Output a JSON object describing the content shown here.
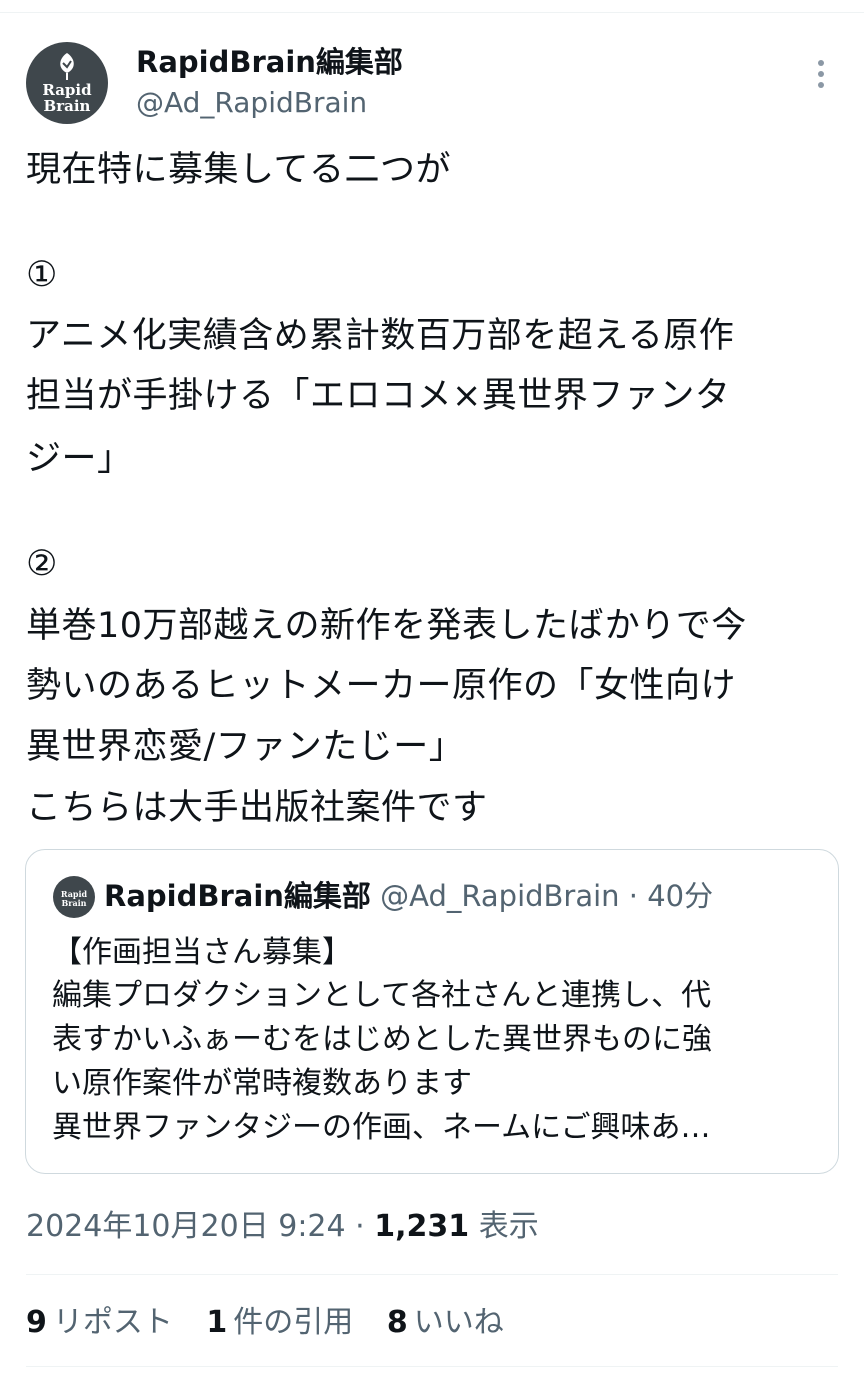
{
  "author": {
    "display_name": "RapidBrain編集部",
    "handle": "@Ad_RapidBrain",
    "avatar_text": [
      "Rapid",
      "Brain"
    ]
  },
  "tweet": {
    "lines": [
      "現在特に募集してる二つが",
      "①",
      "アニメ化実績含め累計数百万部を超える原作",
      "担当が手掛ける「エロコメ×異世界ファンタ",
      "ジー」",
      "②",
      "単巻10万部越えの新作を発表したばかりで今",
      "勢いのあるヒットメーカー原作の「女性向け",
      "異世界恋愛/ファンたじー」",
      "こちらは大手出版社案件です"
    ]
  },
  "quote": {
    "display_name": "RapidBrain編集部",
    "handle": "@Ad_RapidBrain",
    "separator": "·",
    "time": "40分",
    "avatar_text": [
      "Rapid",
      "Brain"
    ],
    "lines": [
      "【作画担当さん募集】",
      "編集プロダクションとして各社さんと連携し、代",
      "表すかいふぁーむをはじめとした異世界ものに強",
      "い原作案件が常時複数あります",
      "異世界ファンタジーの作画、ネームにご興味あ…"
    ]
  },
  "meta": {
    "timestamp": "2024年10月20日 9:24",
    "separator": "·",
    "views_count": "1,231",
    "views_label": "表示"
  },
  "stats": {
    "reposts_count": "9",
    "reposts_label": "リポスト",
    "quotes_count": "1",
    "quotes_label": "件の引用",
    "likes_count": "8",
    "likes_label": "いいね"
  },
  "icons": {
    "more": "more-vertical-icon",
    "avatar_leaf": "leaf-icon"
  },
  "colors": {
    "text_primary": "#0f1419",
    "text_secondary": "#536471",
    "border": "#cfd9de",
    "avatar_bg": "#3f474c"
  }
}
